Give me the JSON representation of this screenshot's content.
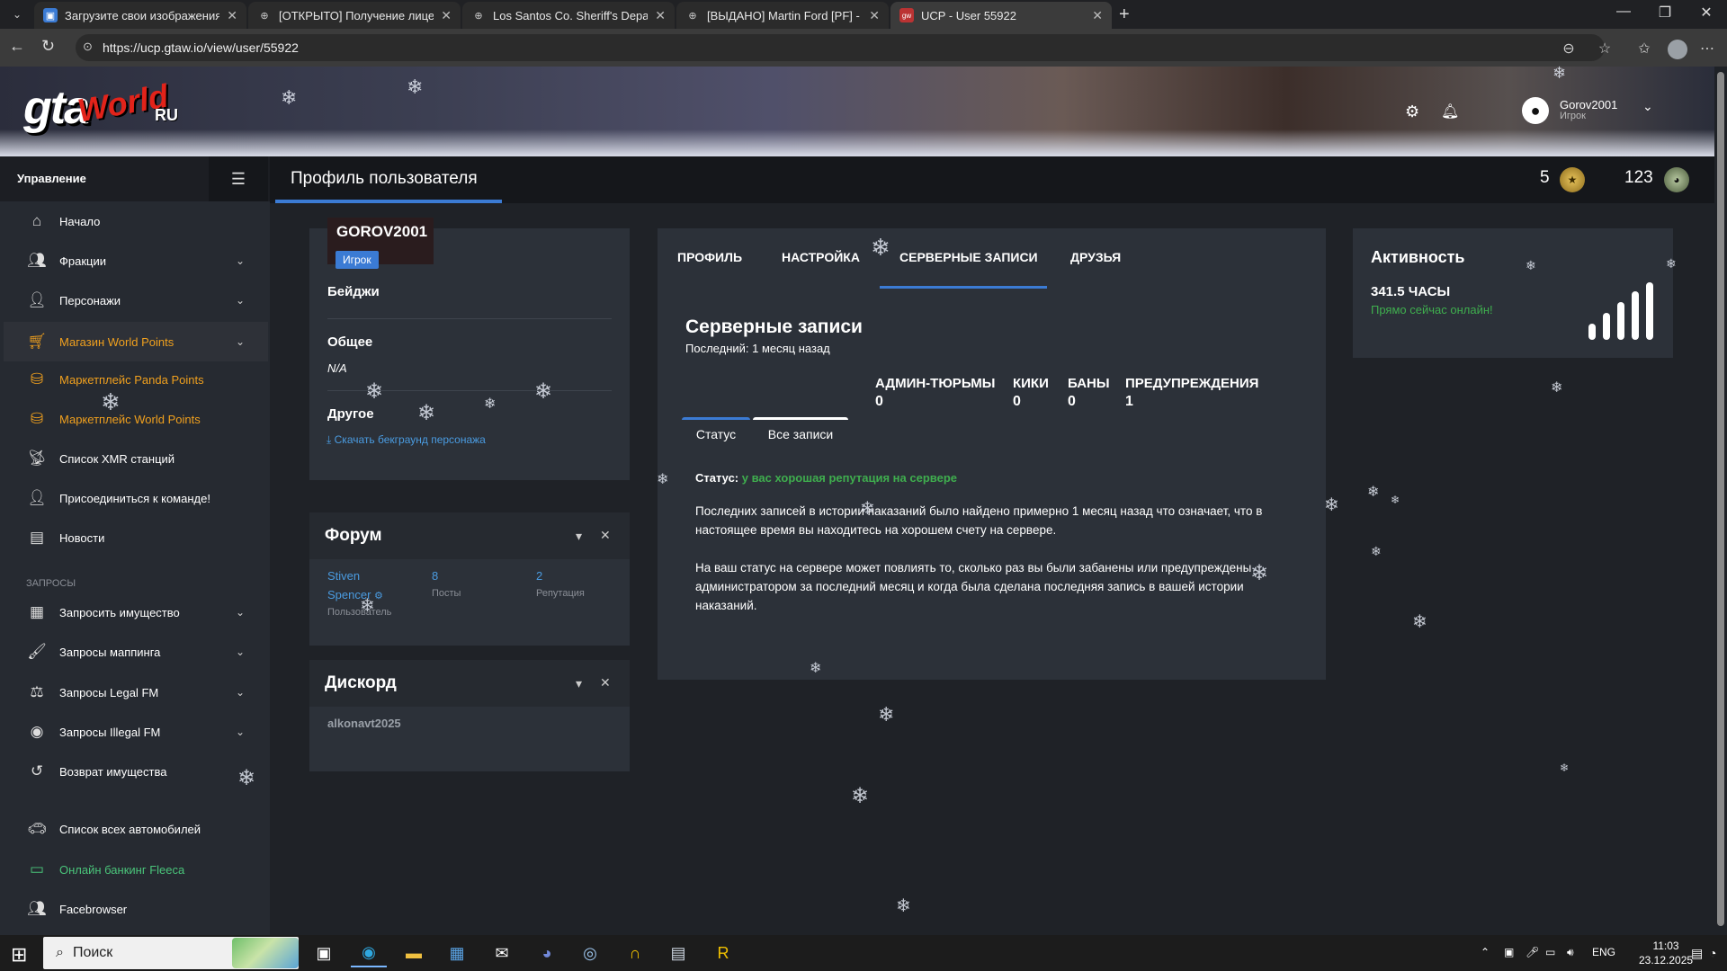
{
  "browser": {
    "tabs": [
      {
        "title": "Загрузите свои изображения",
        "icon": "image-upload-icon",
        "active": false
      },
      {
        "title": "[ОТКРЫТО] Получение лицензи",
        "icon": "globe-icon",
        "active": false
      },
      {
        "title": "Los Santos Co. Sheriff's Departme",
        "icon": "globe-icon",
        "active": false
      },
      {
        "title": "[ВЫДАНО] Martin Ford [PF] - Los",
        "icon": "globe-icon",
        "active": false
      },
      {
        "title": "UCP - User 55922",
        "icon": "gtaw-icon",
        "active": true
      }
    ],
    "url": "https://ucp.gtaw.io/view/user/55922"
  },
  "site": {
    "logo_main": "gta",
    "logo_script": "World",
    "logo_ru": "RU",
    "user": {
      "name": "Gorov2001",
      "role": "Игрок"
    }
  },
  "sidebar": {
    "title": "Управление",
    "items": [
      {
        "label": "Начало",
        "icon": "home-icon",
        "chevron": false,
        "style": "normal"
      },
      {
        "label": "Фракции",
        "icon": "users-icon",
        "chevron": true,
        "style": "normal"
      },
      {
        "label": "Персонажи",
        "icon": "user-icon",
        "chevron": true,
        "style": "normal"
      },
      {
        "label": "Магазин World Points",
        "icon": "cart-icon",
        "chevron": true,
        "style": "orange-highlight"
      },
      {
        "label": "Маркетплейс Panda Points",
        "icon": "coins-icon",
        "chevron": false,
        "style": "orange"
      },
      {
        "label": "Маркетплейс World Points",
        "icon": "coins-icon",
        "chevron": false,
        "style": "orange"
      },
      {
        "label": "Список XMR станций",
        "icon": "antenna-icon",
        "chevron": false,
        "style": "normal"
      },
      {
        "label": "Присоединиться к команде!",
        "icon": "user-tie-icon",
        "chevron": false,
        "style": "normal"
      },
      {
        "label": "Новости",
        "icon": "newspaper-icon",
        "chevron": false,
        "style": "normal"
      }
    ],
    "section_label": "ЗАПРОСЫ",
    "request_items": [
      {
        "label": "Запросить имущество",
        "icon": "building-icon",
        "chevron": true,
        "style": "normal"
      },
      {
        "label": "Запросы маппинга",
        "icon": "brush-icon",
        "chevron": true,
        "style": "normal"
      },
      {
        "label": "Запросы Legal FM",
        "icon": "scale-icon",
        "chevron": true,
        "style": "normal"
      },
      {
        "label": "Запросы Illegal FM",
        "icon": "mask-icon",
        "chevron": true,
        "style": "normal"
      },
      {
        "label": "Возврат имущества",
        "icon": "undo-icon",
        "chevron": false,
        "style": "normal"
      },
      {
        "label": "Список всех автомобилей",
        "icon": "car-icon",
        "chevron": false,
        "style": "normal"
      },
      {
        "label": "Онлайн банкинг Fleeca",
        "icon": "money-icon",
        "chevron": false,
        "style": "green"
      },
      {
        "label": "Facebrowser",
        "icon": "people-icon",
        "chevron": false,
        "style": "normal"
      }
    ]
  },
  "header": {
    "title": "Профиль пользователя",
    "world_points": "5",
    "panda_points": "123"
  },
  "profile": {
    "name": "GOROV2001",
    "role": "Игрок",
    "badges_title": "Бейджи",
    "general_title": "Общее",
    "general_value": "N/A",
    "other_title": "Другое",
    "download_link": "Скачать бекграунд персонажа"
  },
  "forum": {
    "title": "Форум",
    "user_first": "Stiven",
    "user_last": "Spencer",
    "user_label": "Пользователь",
    "posts": "8",
    "posts_label": "Посты",
    "reputation": "2",
    "reputation_label": "Репутация"
  },
  "discord": {
    "title": "Дискорд",
    "username": "alkonavt2025"
  },
  "records": {
    "tabs": [
      "ПРОФИЛЬ",
      "НАСТРОЙКА",
      "СЕРВЕРНЫЕ ЗАПИСИ",
      "ДРУЗЬЯ"
    ],
    "active_tab": "СЕРВЕРНЫЕ ЗАПИСИ",
    "title": "Серверные записи",
    "last": "Последний: 1 месяц назад",
    "stats": [
      {
        "label": "АДМИН-ТЮРЬМЫ",
        "value": "0"
      },
      {
        "label": "КИКИ",
        "value": "0"
      },
      {
        "label": "БАНЫ",
        "value": "0"
      },
      {
        "label": "ПРЕДУПРЕЖДЕНИЯ",
        "value": "1"
      }
    ],
    "subtabs": [
      "Статус",
      "Все записи"
    ],
    "status_label": "Статус:",
    "status_value": "у вас хорошая репутация на сервере",
    "paragraph1": "Последних записей в истории наказаний было найдено примерно 1 месяц назад что означает, что в настоящее время вы находитесь на хорошем счету на сервере.",
    "paragraph2": "На ваш статус на сервере может повлиять то, сколько раз вы были забанены или предупреждены администратором за последний месяц и когда была сделана последняя запись в вашей истории наказаний."
  },
  "activity": {
    "title": "Активность",
    "hours": "341.5 ЧАСЫ",
    "online": "Прямо сейчас онлайн!"
  },
  "taskbar": {
    "search_placeholder": "Поиск",
    "lang": "ENG",
    "time": "11:03",
    "date": "23.12.2025"
  },
  "colors": {
    "accent": "#3b7bd4",
    "orange": "#f0a01e",
    "green": "#3fae4e"
  }
}
